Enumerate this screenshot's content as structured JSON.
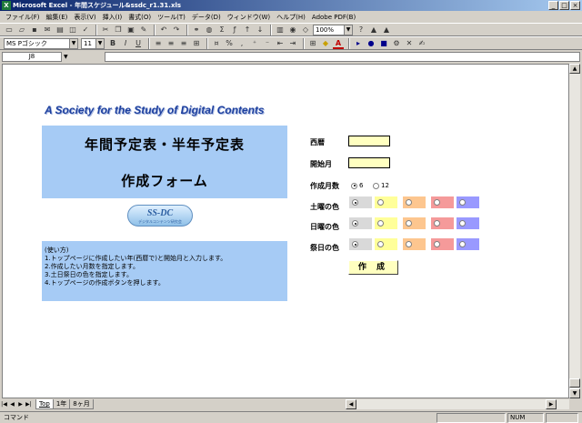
{
  "window": {
    "title": "Microsoft Excel - 年間スケジュール&ssdc_r1.31.xls",
    "app_icon_glyph": "X",
    "buttons": [
      "_",
      "□",
      "×"
    ]
  },
  "menu": {
    "items": [
      "ファイル(F)",
      "編集(E)",
      "表示(V)",
      "挿入(I)",
      "書式(O)",
      "ツール(T)",
      "データ(D)",
      "ウィンドウ(W)",
      "ヘルプ(H)",
      "Adobe PDF(B)"
    ]
  },
  "toolbar": {
    "zoom": "100%",
    "font_name": "MS Pゴシック",
    "font_size": "11",
    "bold": "B",
    "italic": "I",
    "underline": "U",
    "font_color_glyph": "A"
  },
  "formula_bar": {
    "cell_ref": "J8",
    "content": ""
  },
  "sheet": {
    "banner": "A Society for the Study of Digital Contents",
    "title_line1": "年間予定表・半年予定表",
    "title_line2": "作成フォーム",
    "logo_main": "SS-DC",
    "logo_sub": "デジタルコンテンツ研究会",
    "usage": [
      "(使い方)",
      "1.トップページに作成したい年(西暦で)と開始月と入力します。",
      "2.作成したい月数を指定します。",
      "3.土日祭日の色を指定します。",
      "4.トップページの作成ボタンを押します。"
    ],
    "form": {
      "year_label": "西暦",
      "year_value": "",
      "start_month_label": "開始月",
      "start_month_value": "",
      "month_count_label": "作成月数",
      "month_options": [
        "6",
        "12"
      ],
      "month_selected": "6",
      "saturday_label": "土曜の色",
      "sunday_label": "日曜の色",
      "holiday_label": "祭日の色",
      "color_swatches": [
        "#d9d9d9",
        "#ffff99",
        "#fdc68f",
        "#f59a9a",
        "#9999ff"
      ],
      "saturday_selected": 0,
      "sunday_selected": 0,
      "holiday_selected": 0,
      "create_button": "作 成"
    }
  },
  "tabs": {
    "items": [
      "Top",
      "1年",
      "8ヶ月"
    ],
    "active": "Top"
  },
  "status": {
    "mode": "コマンド",
    "num": "NUM"
  }
}
